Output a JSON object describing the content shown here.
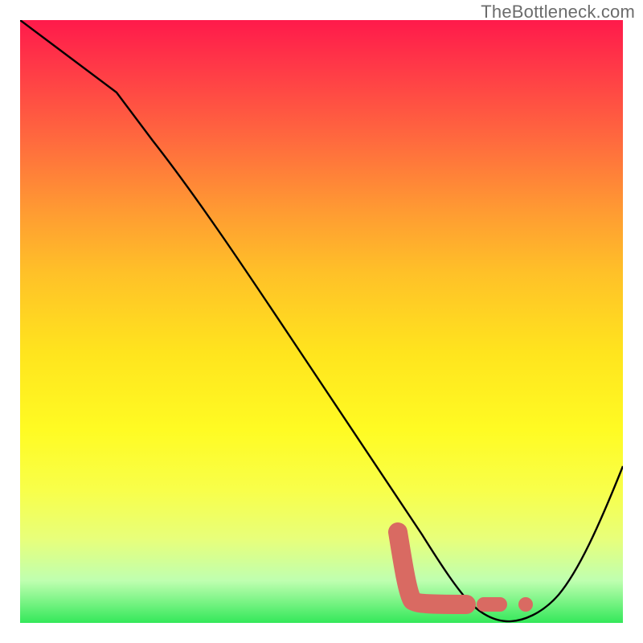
{
  "watermark": {
    "text": "TheBottleneck.com"
  },
  "chart_data": {
    "type": "line",
    "title": "",
    "xlabel": "",
    "ylabel": "",
    "xlim": [
      0,
      100
    ],
    "ylim": [
      0,
      100
    ],
    "grid": false,
    "legend": false,
    "series": [
      {
        "name": "bottleneck-curve",
        "x": [
          0,
          5,
          10,
          15,
          20,
          25,
          30,
          35,
          40,
          45,
          50,
          55,
          60,
          63,
          66,
          70,
          75,
          80,
          84,
          88,
          92,
          96,
          100
        ],
        "y": [
          100,
          96,
          92,
          88,
          84,
          79,
          70,
          62,
          54,
          46,
          38,
          30,
          23,
          16,
          10,
          4,
          1,
          0,
          1,
          4,
          10,
          18,
          28
        ]
      }
    ],
    "marker": {
      "name": "optimal-region",
      "segments": [
        {
          "type": "body",
          "x": [
            62,
            63,
            66,
            74
          ],
          "y": [
            18,
            6,
            3,
            3
          ]
        },
        {
          "type": "dash",
          "x": [
            77,
            80
          ],
          "y": [
            3,
            3
          ]
        },
        {
          "type": "dot",
          "x": 84,
          "y": 3
        }
      ]
    },
    "background_gradient": {
      "top_color": "#ff1a4b",
      "bottom_color": "#34e85a",
      "direction": "vertical"
    }
  }
}
